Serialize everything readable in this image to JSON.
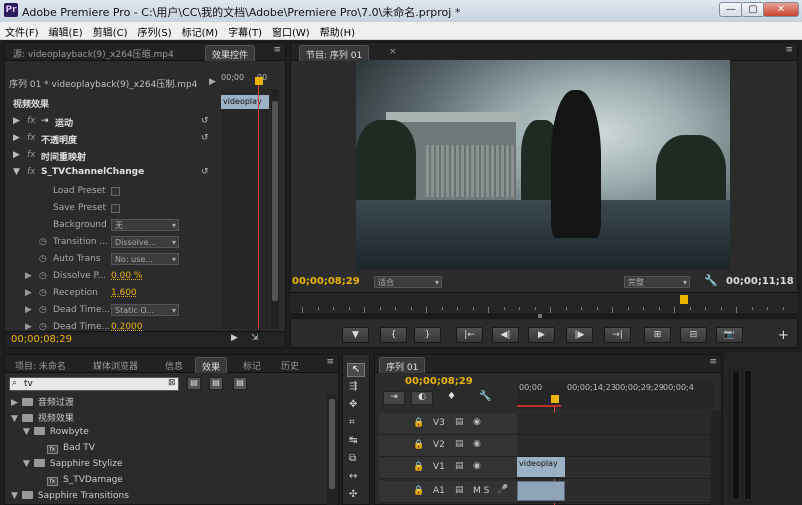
{
  "window": {
    "logo_text": "Pr",
    "title": "Adobe Premiere Pro - C:\\用户\\CC\\我的文档\\Adobe\\Premiere Pro\\7.0\\未命名.prproj *",
    "min": "—",
    "max": "▢",
    "close": "✕"
  },
  "menu": [
    "文件(F)",
    "编辑(E)",
    "剪辑(C)",
    "序列(S)",
    "标记(M)",
    "字幕(T)",
    "窗口(W)",
    "帮助(H)"
  ],
  "effect_controls": {
    "tab_source": "源: videoplayback(9)_x264压缩.mp4",
    "tab_effect": "效果控件",
    "tab_menu": "≡",
    "sequence_clip": "序列 01 * videoplayback(9)_x264压制.mp4",
    "time_start": "00;00",
    "time_end": "00",
    "clip_label": "videoplay",
    "section": "视频效果",
    "fx_rows": [
      {
        "prefix": "fx",
        "label": "运动",
        "icon": "motion-icon"
      },
      {
        "prefix": "fx",
        "label": "不透明度",
        "icon": ""
      },
      {
        "prefix": "fx",
        "label": "时间重映射",
        "icon": ""
      },
      {
        "prefix": "fx",
        "label": "S_TVChannelChange",
        "icon": ""
      }
    ],
    "params": [
      {
        "label": "Load Preset",
        "kind": "checkbox"
      },
      {
        "label": "Save Preset",
        "kind": "checkbox"
      },
      {
        "label": "Background",
        "kind": "dropdown",
        "value": "无"
      },
      {
        "label": "Transition ...",
        "kind": "dropdown",
        "value": "Dissolve..."
      },
      {
        "label": "Auto Trans",
        "kind": "dropdown",
        "value": "No: use..."
      },
      {
        "label": "Dissolve P...",
        "kind": "value",
        "value": "0.00 %"
      },
      {
        "label": "Reception",
        "kind": "value",
        "value": "1.600"
      },
      {
        "label": "Dead Time...",
        "kind": "dropdown",
        "value": "Static O..."
      },
      {
        "label": "Dead Time...",
        "kind": "value",
        "value": "0.2000"
      }
    ],
    "timecode": "00;00;08;29"
  },
  "program": {
    "tab": "节目: 序列 01",
    "tab_menu": "≡",
    "timecode": "00;00;08;29",
    "fit": "适合",
    "quality": "完整",
    "duration": "00;00;11;18",
    "transport": [
      "▼",
      "{",
      "}",
      "|←",
      "◀|",
      "▶",
      "|▶",
      "→|",
      "⊞",
      "⊟",
      "📷"
    ],
    "add": "+"
  },
  "project": {
    "tabs": [
      "项目: 未命名",
      "媒体浏览器",
      "信息",
      "效果",
      "标记",
      "历史"
    ],
    "tab_menu": "≡",
    "search_value": "tv",
    "tree": [
      {
        "indent": 0,
        "label": "音频过渡",
        "kind": "folder",
        "open": false
      },
      {
        "indent": 0,
        "label": "视频效果",
        "kind": "folder",
        "open": true
      },
      {
        "indent": 1,
        "label": "Rowbyte",
        "kind": "folder",
        "open": true
      },
      {
        "indent": 2,
        "label": "Bad TV",
        "kind": "fx"
      },
      {
        "indent": 1,
        "label": "Sapphire Stylize",
        "kind": "folder",
        "open": true
      },
      {
        "indent": 2,
        "label": "S_TVDamage",
        "kind": "fx"
      },
      {
        "indent": 0,
        "label": "Sapphire Transitions",
        "kind": "folder",
        "open": true
      }
    ]
  },
  "timeline": {
    "tab": "序列 01",
    "tab_menu": "≡",
    "timecode": "00;00;08;29",
    "ruler": [
      "00;00",
      "00;00;14;23",
      "00;00;29;29",
      "00;00;4"
    ],
    "tracks": [
      {
        "name": "V3"
      },
      {
        "name": "V2"
      },
      {
        "name": "V1"
      },
      {
        "name": "A1"
      }
    ],
    "clip_label": "videoplay",
    "a1_extra": "M S"
  },
  "colors": {
    "accent": "#e9b400",
    "playhead": "#e04040"
  }
}
